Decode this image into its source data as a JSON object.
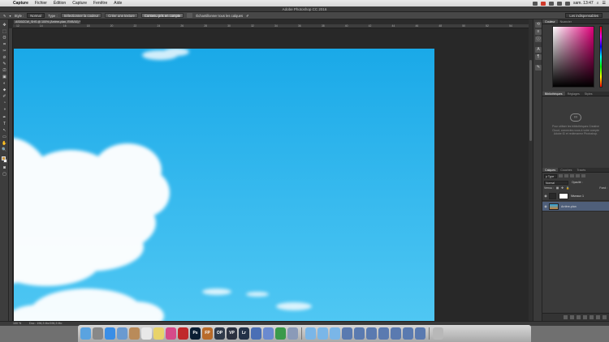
{
  "menubar": {
    "app_name": "Capture",
    "items": [
      "Fichier",
      "Édition",
      "Capture",
      "Fenêtre",
      "Aide"
    ],
    "clock": "sam. 13:47"
  },
  "window": {
    "title": "Adobe Photoshop CC 2016"
  },
  "options_bar": {
    "style_label": "Style :",
    "style_value": "Normal",
    "type_label": "Type :",
    "buttons": [
      "Sélectionner la couleur",
      "Créer une texture",
      "Contenu pris en compte"
    ],
    "sample_all": "Échantillonner tous les calques",
    "workspace": "Les indispensables"
  },
  "document": {
    "tab_label": "AS00ZCW_SHS @ 100% (Arrière-plan, RVB/16) *",
    "zoom": "100 %",
    "doc_info": "Doc : 196,3 Mo/196,3 Mo"
  },
  "ruler": {
    "h_ticks": [
      "12",
      "14",
      "16",
      "18",
      "20",
      "22",
      "24",
      "26",
      "28",
      "30",
      "32",
      "34",
      "36",
      "38",
      "40",
      "42",
      "44",
      "46",
      "48",
      "50",
      "52",
      "54"
    ]
  },
  "panels": {
    "color_tabs": [
      "Couleur",
      "Nuancier"
    ],
    "library_tabs": [
      "Bibliothèques",
      "Réglages",
      "Styles"
    ],
    "library_message": "Pour utiliser les bibliothèques Creative Cloud, connectez-vous à votre compte Adobe ID et redémarrez Photoshop.",
    "layers_tabs": [
      "Calques",
      "Couches",
      "Tracés"
    ],
    "filter_label": "ρ Type",
    "blend_mode": "Normal",
    "opacity_label": "Opacité :",
    "lock_label": "Verrou :",
    "fill_label": "Fond :",
    "layers": [
      {
        "name": "Niveaux 1",
        "selected": false
      },
      {
        "name": "Arrière-plan",
        "selected": true
      }
    ]
  },
  "toolbox": {
    "tool_glyphs": [
      "✥",
      "⬚",
      "ʘ",
      "⌗",
      "✂",
      "⊘",
      "✎",
      "⎚",
      "▣",
      "◐",
      "⬥",
      "✐",
      "T",
      "↖",
      "▭",
      "✋",
      "🔍"
    ]
  },
  "colors": {
    "sky_top": "#1aa9e8",
    "sky_bottom": "#4fc7f3",
    "foreground_swatch": "#c8923a"
  },
  "dock": {
    "icons": [
      {
        "icon": "finder-icon",
        "label": "",
        "color": "#5aa3e0"
      },
      {
        "icon": "launchpad-icon",
        "label": "",
        "color": "#888"
      },
      {
        "icon": "safari-icon",
        "label": "",
        "color": "#3a8ee6"
      },
      {
        "icon": "mail-icon",
        "label": "",
        "color": "#6a9ad0"
      },
      {
        "icon": "contacts-icon",
        "label": "",
        "color": "#b98b5a"
      },
      {
        "icon": "calendar-icon",
        "label": "",
        "color": "#e8e8e8"
      },
      {
        "icon": "notes-icon",
        "label": "",
        "color": "#e8d36a"
      },
      {
        "icon": "itunes-icon",
        "label": "",
        "color": "#d64a8a"
      },
      {
        "icon": "filezilla-icon",
        "label": "",
        "color": "#c0282a"
      },
      {
        "icon": "photoshop-icon",
        "label": "Ps",
        "color": "#0b1e33"
      },
      {
        "icon": "fp-icon",
        "label": "FP",
        "color": "#b86b2a"
      },
      {
        "icon": "dxo-icon",
        "label": "OP",
        "color": "#303a4a"
      },
      {
        "icon": "vp-icon",
        "label": "VP",
        "color": "#2b3140"
      },
      {
        "icon": "lightroom-icon",
        "label": "Lr",
        "color": "#243248"
      },
      {
        "icon": "openoffice-icon",
        "label": "",
        "color": "#4a6fb5"
      },
      {
        "icon": "app-icon",
        "label": "",
        "color": "#6a8ad0"
      },
      {
        "icon": "green-app-icon",
        "label": "",
        "color": "#3a9a4a"
      },
      {
        "icon": "preview-icon",
        "label": "",
        "color": "#8a9ab8"
      },
      {
        "icon": "folder-icon",
        "label": "",
        "color": "#7ab6e8"
      },
      {
        "icon": "folder-icon",
        "label": "",
        "color": "#7ab6e8"
      },
      {
        "icon": "folder-icon",
        "label": "",
        "color": "#7ab6e8"
      },
      {
        "icon": "window-icon",
        "label": "",
        "color": "#5a7ab0"
      },
      {
        "icon": "window-icon",
        "label": "",
        "color": "#5a7ab0"
      },
      {
        "icon": "window-icon",
        "label": "",
        "color": "#5a7ab0"
      },
      {
        "icon": "window-icon",
        "label": "",
        "color": "#5a7ab0"
      },
      {
        "icon": "window-icon",
        "label": "",
        "color": "#5a7ab0"
      },
      {
        "icon": "window-icon",
        "label": "",
        "color": "#5a7ab0"
      },
      {
        "icon": "window-icon",
        "label": "",
        "color": "#5a7ab0"
      },
      {
        "icon": "trash-icon",
        "label": "",
        "color": "#b8b8b8"
      }
    ]
  }
}
